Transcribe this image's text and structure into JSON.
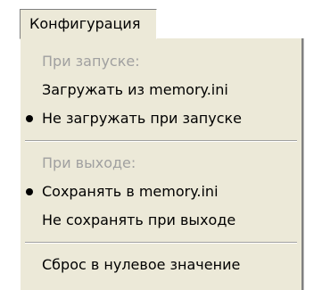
{
  "menubar": {
    "menu_label": "Конфигурация"
  },
  "menu": {
    "startup_header": "При запуске:",
    "load_from_ini": "Загружать из memory.ini",
    "no_load_on_startup": "Не загружать при запуске",
    "exit_header": "При выходе:",
    "save_to_ini": "Сохранять в memory.ini",
    "no_save_on_exit": "Не сохранять при выходе",
    "reset_to_zero": "Сброс в нулевое значение",
    "selected_startup_option": "Не загружать при запуске",
    "selected_exit_option": "Сохранять в memory.ini"
  },
  "colors": {
    "menu_background": "#ece9d8",
    "disabled_text": "#a0a0a0",
    "text": "#000000"
  }
}
